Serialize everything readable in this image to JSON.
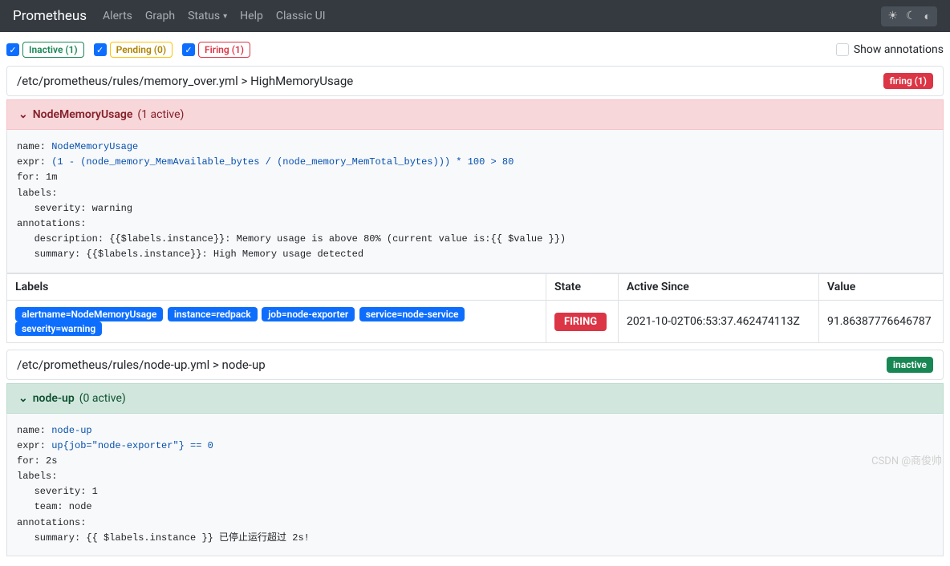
{
  "nav": {
    "brand": "Prometheus",
    "alerts": "Alerts",
    "graph": "Graph",
    "status": "Status",
    "help": "Help",
    "classic": "Classic UI"
  },
  "filters": {
    "inactive": "Inactive (1)",
    "pending": "Pending (0)",
    "firing": "Firing (1)",
    "show_annotations": "Show annotations"
  },
  "rule1": {
    "file": "/etc/prometheus/rules/memory_over.yml > HighMemoryUsage",
    "badge": "firing (1)",
    "group_name": "NodeMemoryUsage",
    "group_active": "(1 active)",
    "code": "name: NodeMemoryUsage\nexpr: (1 - (node_memory_MemAvailable_bytes / (node_memory_MemTotal_bytes))) * 100 > 80\nfor: 1m\nlabels:\n   severity: warning\nannotations:\n   description: {{$labels.instance}}: Memory usage is above 80% (current value is:{{ $value }})\n   summary: {{$labels.instance}}: High Memory usage detected",
    "table": {
      "h_labels": "Labels",
      "h_state": "State",
      "h_active": "Active Since",
      "h_value": "Value",
      "labels": {
        "alertname": "alertname=NodeMemoryUsage",
        "instance": "instance=redpack",
        "job": "job=node-exporter",
        "service": "service=node-service",
        "severity": "severity=warning"
      },
      "state": "FIRING",
      "active_since": "2021-10-02T06:53:37.462474113Z",
      "value": "91.86387776646787"
    }
  },
  "rule2": {
    "file": "/etc/prometheus/rules/node-up.yml > node-up",
    "badge": "inactive",
    "group_name": "node-up",
    "group_active": "(0 active)",
    "code": "name: node-up\nexpr: up{job=\"node-exporter\"} == 0\nfor: 2s\nlabels:\n   severity: 1\n   team: node\nannotations:\n   summary: {{ $labels.instance }} 已停止运行超过 2s!"
  },
  "watermark": "CSDN @商俊帅"
}
